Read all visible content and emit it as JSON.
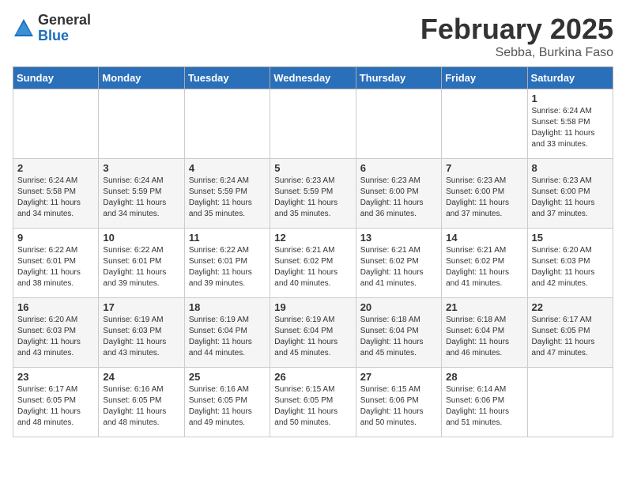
{
  "logo": {
    "general": "General",
    "blue": "Blue"
  },
  "title": "February 2025",
  "subtitle": "Sebba, Burkina Faso",
  "days_of_week": [
    "Sunday",
    "Monday",
    "Tuesday",
    "Wednesday",
    "Thursday",
    "Friday",
    "Saturday"
  ],
  "weeks": [
    [
      {
        "day": "",
        "info": ""
      },
      {
        "day": "",
        "info": ""
      },
      {
        "day": "",
        "info": ""
      },
      {
        "day": "",
        "info": ""
      },
      {
        "day": "",
        "info": ""
      },
      {
        "day": "",
        "info": ""
      },
      {
        "day": "1",
        "info": "Sunrise: 6:24 AM\nSunset: 5:58 PM\nDaylight: 11 hours\nand 33 minutes."
      }
    ],
    [
      {
        "day": "2",
        "info": "Sunrise: 6:24 AM\nSunset: 5:58 PM\nDaylight: 11 hours\nand 34 minutes."
      },
      {
        "day": "3",
        "info": "Sunrise: 6:24 AM\nSunset: 5:59 PM\nDaylight: 11 hours\nand 34 minutes."
      },
      {
        "day": "4",
        "info": "Sunrise: 6:24 AM\nSunset: 5:59 PM\nDaylight: 11 hours\nand 35 minutes."
      },
      {
        "day": "5",
        "info": "Sunrise: 6:23 AM\nSunset: 5:59 PM\nDaylight: 11 hours\nand 35 minutes."
      },
      {
        "day": "6",
        "info": "Sunrise: 6:23 AM\nSunset: 6:00 PM\nDaylight: 11 hours\nand 36 minutes."
      },
      {
        "day": "7",
        "info": "Sunrise: 6:23 AM\nSunset: 6:00 PM\nDaylight: 11 hours\nand 37 minutes."
      },
      {
        "day": "8",
        "info": "Sunrise: 6:23 AM\nSunset: 6:00 PM\nDaylight: 11 hours\nand 37 minutes."
      }
    ],
    [
      {
        "day": "9",
        "info": "Sunrise: 6:22 AM\nSunset: 6:01 PM\nDaylight: 11 hours\nand 38 minutes."
      },
      {
        "day": "10",
        "info": "Sunrise: 6:22 AM\nSunset: 6:01 PM\nDaylight: 11 hours\nand 39 minutes."
      },
      {
        "day": "11",
        "info": "Sunrise: 6:22 AM\nSunset: 6:01 PM\nDaylight: 11 hours\nand 39 minutes."
      },
      {
        "day": "12",
        "info": "Sunrise: 6:21 AM\nSunset: 6:02 PM\nDaylight: 11 hours\nand 40 minutes."
      },
      {
        "day": "13",
        "info": "Sunrise: 6:21 AM\nSunset: 6:02 PM\nDaylight: 11 hours\nand 41 minutes."
      },
      {
        "day": "14",
        "info": "Sunrise: 6:21 AM\nSunset: 6:02 PM\nDaylight: 11 hours\nand 41 minutes."
      },
      {
        "day": "15",
        "info": "Sunrise: 6:20 AM\nSunset: 6:03 PM\nDaylight: 11 hours\nand 42 minutes."
      }
    ],
    [
      {
        "day": "16",
        "info": "Sunrise: 6:20 AM\nSunset: 6:03 PM\nDaylight: 11 hours\nand 43 minutes."
      },
      {
        "day": "17",
        "info": "Sunrise: 6:19 AM\nSunset: 6:03 PM\nDaylight: 11 hours\nand 43 minutes."
      },
      {
        "day": "18",
        "info": "Sunrise: 6:19 AM\nSunset: 6:04 PM\nDaylight: 11 hours\nand 44 minutes."
      },
      {
        "day": "19",
        "info": "Sunrise: 6:19 AM\nSunset: 6:04 PM\nDaylight: 11 hours\nand 45 minutes."
      },
      {
        "day": "20",
        "info": "Sunrise: 6:18 AM\nSunset: 6:04 PM\nDaylight: 11 hours\nand 45 minutes."
      },
      {
        "day": "21",
        "info": "Sunrise: 6:18 AM\nSunset: 6:04 PM\nDaylight: 11 hours\nand 46 minutes."
      },
      {
        "day": "22",
        "info": "Sunrise: 6:17 AM\nSunset: 6:05 PM\nDaylight: 11 hours\nand 47 minutes."
      }
    ],
    [
      {
        "day": "23",
        "info": "Sunrise: 6:17 AM\nSunset: 6:05 PM\nDaylight: 11 hours\nand 48 minutes."
      },
      {
        "day": "24",
        "info": "Sunrise: 6:16 AM\nSunset: 6:05 PM\nDaylight: 11 hours\nand 48 minutes."
      },
      {
        "day": "25",
        "info": "Sunrise: 6:16 AM\nSunset: 6:05 PM\nDaylight: 11 hours\nand 49 minutes."
      },
      {
        "day": "26",
        "info": "Sunrise: 6:15 AM\nSunset: 6:05 PM\nDaylight: 11 hours\nand 50 minutes."
      },
      {
        "day": "27",
        "info": "Sunrise: 6:15 AM\nSunset: 6:06 PM\nDaylight: 11 hours\nand 50 minutes."
      },
      {
        "day": "28",
        "info": "Sunrise: 6:14 AM\nSunset: 6:06 PM\nDaylight: 11 hours\nand 51 minutes."
      },
      {
        "day": "",
        "info": ""
      }
    ]
  ]
}
